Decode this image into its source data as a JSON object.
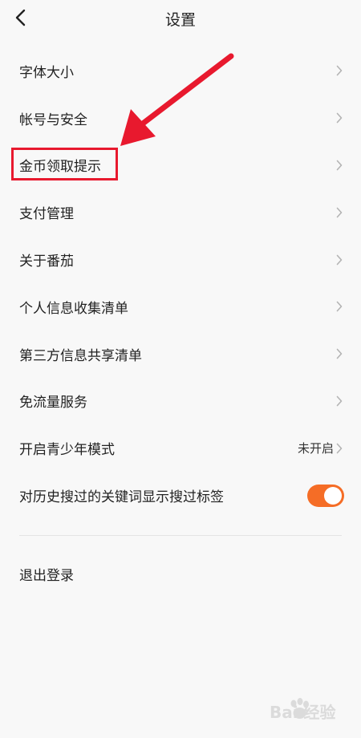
{
  "header": {
    "title": "设置"
  },
  "settings": {
    "items": [
      {
        "label": "字体大小"
      },
      {
        "label": "帐号与安全"
      },
      {
        "label": "金币领取提示"
      },
      {
        "label": "支付管理"
      },
      {
        "label": "关于番茄"
      },
      {
        "label": "个人信息收集清单"
      },
      {
        "label": "第三方信息共享清单"
      },
      {
        "label": "免流量服务"
      },
      {
        "label": "开启青少年模式",
        "value": "未开启"
      },
      {
        "label": "对历史搜过的关键词显示搜过标签",
        "toggle_on": true
      }
    ]
  },
  "logout_label": "退出登录",
  "watermark": {
    "text": "Bai 经验"
  },
  "colors": {
    "toggle_on": "#f56d26",
    "annotation_red": "#e8192e",
    "chevron": "#b4b4b4"
  }
}
